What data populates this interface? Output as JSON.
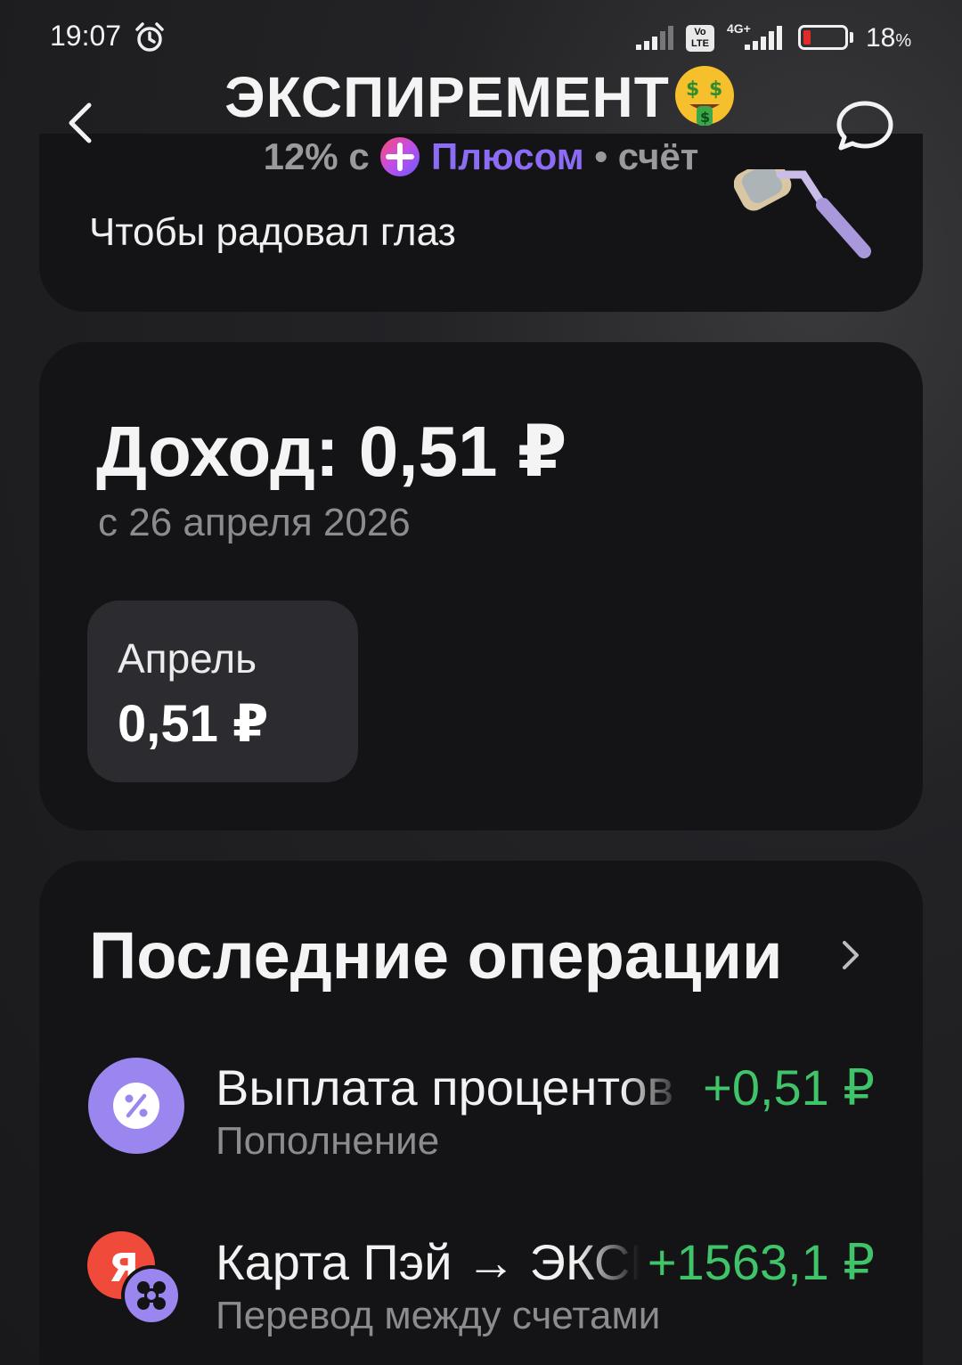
{
  "status_bar": {
    "time": "19:07",
    "network": "4G+",
    "volte": "Vo LTE",
    "battery_percent": "18",
    "battery_unit": "%",
    "battery_level": 0.18
  },
  "header": {
    "title": "ЭКСПИРЕМЕНТ",
    "subtitle_rate": "12% с",
    "subtitle_plus": "Плюсом",
    "subtitle_tail": "• счёт"
  },
  "promo_card": {
    "text": "Чтобы радовал глаз"
  },
  "income": {
    "title": "Доход: 0,51 ₽",
    "since": "с 26 апреля 2026",
    "month": {
      "name": "Апрель",
      "value": "0,51 ₽"
    }
  },
  "operations": {
    "title": "Последние операции",
    "items": [
      {
        "title": "Выплата процентов",
        "amount": "+0,51 ₽",
        "subtitle": "Пополнение",
        "icon": "percent-icon"
      },
      {
        "title": "Карта Пэй → ЭКСПИРЕМЕНТ",
        "amount": "+1563,1 ₽",
        "subtitle": "Перевод между счетами",
        "icon": "yandex-logo-icon"
      }
    ]
  },
  "colors": {
    "accent_purple": "#8c6cf5",
    "income_green": "#3fc46a",
    "card_bg": "#141416",
    "tile_bg": "#2c2c30"
  }
}
